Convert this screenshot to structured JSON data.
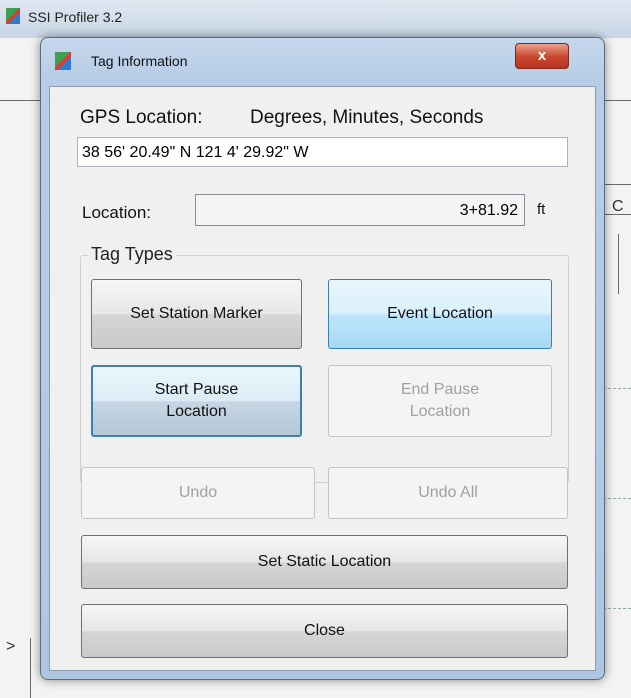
{
  "app": {
    "title": "SSI Profiler 3.2"
  },
  "background": {
    "left_marker": ">",
    "right_marker": "C"
  },
  "dialog": {
    "title": "Tag Information",
    "close_glyph": "x",
    "gps_label": "GPS Location:",
    "gps_format": "Degrees, Minutes, Seconds",
    "gps_value": "38 56' 20.49\" N 121 4' 29.92\" W",
    "location_label": "Location:",
    "location_value": "3+81.92",
    "location_unit": "ft",
    "tag_types_title": "Tag Types",
    "buttons": {
      "set_station_marker": "Set Station Marker",
      "event_location": "Event Location",
      "start_pause_line1": "Start Pause",
      "start_pause_line2": "Location",
      "end_pause_line1": "End Pause",
      "end_pause_line2": "Location",
      "undo": "Undo",
      "undo_all": "Undo All",
      "set_static_location": "Set Static Location",
      "close": "Close"
    }
  },
  "colors": {
    "accent_blue": "#3c7fb1",
    "close_red": "#c9442c"
  }
}
